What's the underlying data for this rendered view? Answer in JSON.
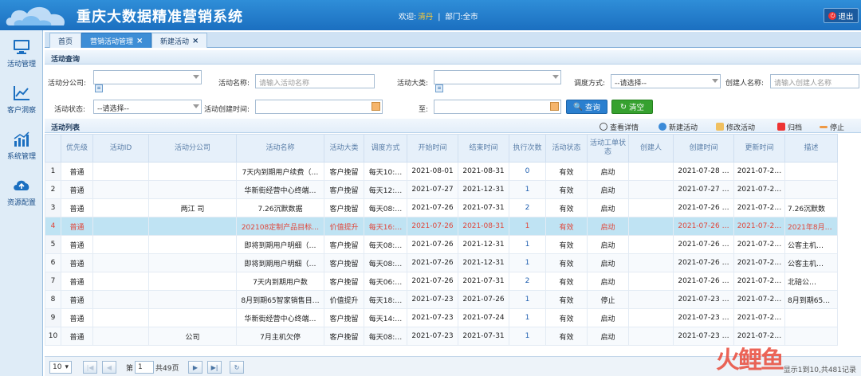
{
  "header": {
    "title": "重庆大数据精准营销系统",
    "welcome_label": "欢迎:",
    "user_name": "清丹",
    "dept_label": "部门:",
    "dept_value": "全市",
    "logout_label": "退出"
  },
  "sidebar": {
    "items": [
      {
        "label": "活动管理",
        "icon": "monitor-icon"
      },
      {
        "label": "客户洞察",
        "icon": "line-chart-icon"
      },
      {
        "label": "系统管理",
        "icon": "bar-chart-icon"
      },
      {
        "label": "资源配置",
        "icon": "cloud-upload-icon"
      }
    ]
  },
  "tabs": [
    {
      "label": "首页",
      "closable": false
    },
    {
      "label": "营销活动管理",
      "closable": true
    },
    {
      "label": "新建活动",
      "closable": true
    }
  ],
  "query": {
    "section_title": "活动查询",
    "branch_label": "活动分公司:",
    "name_label": "活动名称:",
    "name_placeholder": "请输入活动名称",
    "category_label": "活动大类:",
    "schedule_label": "调度方式:",
    "schedule_value": "--请选择--",
    "creator_label": "创建人名称:",
    "creator_placeholder": "请输入创建人名称",
    "status_label": "活动状态:",
    "status_value": "--请选择--",
    "created_label": "活动创建时间:",
    "to_label": "至:",
    "search_label": "查询",
    "clear_label": "清空"
  },
  "list": {
    "section_title": "活动列表",
    "tools": [
      {
        "label": "查看详情",
        "icon": "magnifier-icon"
      },
      {
        "label": "新建活动",
        "icon": "plus-icon"
      },
      {
        "label": "修改活动",
        "icon": "edit-icon"
      },
      {
        "label": "归档",
        "icon": "x-icon"
      },
      {
        "label": "停止",
        "icon": "minus-icon"
      }
    ],
    "columns": [
      "",
      "优先级",
      "活动ID",
      "活动分公司",
      "活动名称",
      "活动大类",
      "调度方式",
      "开始时间",
      "结束时间",
      "执行次数",
      "活动状态",
      "活动工单状态",
      "创建人",
      "创建时间",
      "更新时间",
      "描述"
    ],
    "rows": [
      [
        "1",
        "普通",
        "",
        "",
        "7天内到期用户续费（…",
        "客户挽留",
        "每天10:…",
        "2021-08-01",
        "2021-08-31",
        "0",
        "有效",
        "启动",
        "",
        "2021-07-28 …",
        "2021-07-2…",
        ""
      ],
      [
        "2",
        "普通",
        "",
        "",
        "华新街经营中心终端…",
        "客户挽留",
        "每天12:…",
        "2021-07-27",
        "2021-12-31",
        "1",
        "有效",
        "启动",
        "",
        "2021-07-27 …",
        "2021-07-2…",
        ""
      ],
      [
        "3",
        "普通",
        "",
        "两江 司",
        "7.26沉默数据",
        "客户挽留",
        "每天08:…",
        "2021-07-26",
        "2021-07-31",
        "2",
        "有效",
        "启动",
        "",
        "2021-07-26 …",
        "2021-07-2…",
        "7.26沉默数"
      ],
      [
        "4",
        "普通",
        "",
        "",
        "202108定制产品目标…",
        "价值提升",
        "每天16:…",
        "2021-07-26",
        "2021-08-31",
        "1",
        "有效",
        "启动",
        "",
        "2021-07-26 …",
        "2021-07-2…",
        "2021年8月…"
      ],
      [
        "5",
        "普通",
        "",
        "",
        "即将到期用户明细（…",
        "客户挽留",
        "每天08:…",
        "2021-07-26",
        "2021-12-31",
        "1",
        "有效",
        "启动",
        "",
        "2021-07-26 …",
        "2021-07-2…",
        "公客主机…"
      ],
      [
        "6",
        "普通",
        "",
        "",
        "即将到期用户明细（…",
        "客户挽留",
        "每天08:…",
        "2021-07-26",
        "2021-12-31",
        "1",
        "有效",
        "启动",
        "",
        "2021-07-26 …",
        "2021-07-2…",
        "公客主机…"
      ],
      [
        "7",
        "普通",
        "",
        "",
        "7天内到期用户数",
        "客户挽留",
        "每天06:…",
        "2021-07-26",
        "2021-07-31",
        "2",
        "有效",
        "启动",
        "",
        "2021-07-26 …",
        "2021-07-2…",
        "北碚公…"
      ],
      [
        "8",
        "普通",
        "",
        "",
        "8月到期65智家销售目…",
        "价值提升",
        "每天18:…",
        "2021-07-23",
        "2021-07-26",
        "1",
        "有效",
        "停止",
        "",
        "2021-07-23 …",
        "2021-07-2…",
        "8月到期65…"
      ],
      [
        "9",
        "普通",
        "",
        "",
        "华新街经营中心终端…",
        "客户挽留",
        "每天14:…",
        "2021-07-23",
        "2021-07-24",
        "1",
        "有效",
        "启动",
        "",
        "2021-07-23 …",
        "2021-07-2…",
        ""
      ],
      [
        "10",
        "普通",
        "",
        "公司",
        "7月主机欠停",
        "客户挽留",
        "每天08:…",
        "2021-07-23",
        "2021-07-31",
        "1",
        "有效",
        "启动",
        "",
        "2021-07-23 …",
        "2021-07-2…",
        ""
      ]
    ],
    "selected_row": 3
  },
  "pager": {
    "page_size": "10",
    "page_prefix": "第",
    "page_value": "1",
    "page_total": "共49页",
    "summary": "显示1到10,共481记录"
  },
  "watermark": "火鲤鱼",
  "colors": {
    "header": "#1b6fc0",
    "accent": "#2a7fcf",
    "selected_row": "#bfe3f3",
    "selected_text": "#e0463a"
  }
}
